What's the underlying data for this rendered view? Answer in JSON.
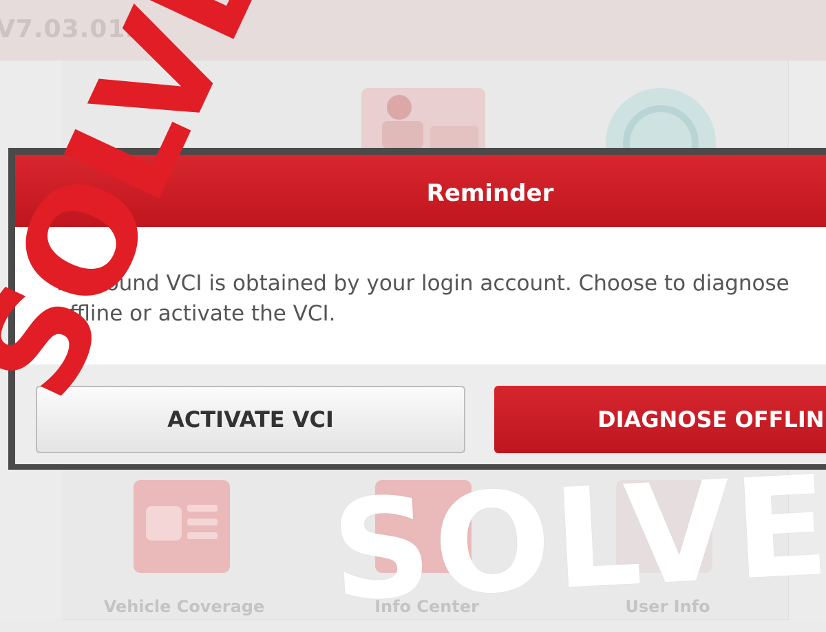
{
  "app": {
    "version": "V7.03.012"
  },
  "tiles": [
    {
      "label": "",
      "icon": "mechanic-icon"
    },
    {
      "label": "",
      "icon": "update-icon"
    },
    {
      "label": "Vehicle Coverage",
      "icon": "vehicle-coverage-icon"
    },
    {
      "label": "Info Center",
      "icon": "info-center-icon"
    },
    {
      "label": "User Info",
      "icon": "user-info-icon"
    }
  ],
  "dialog": {
    "title": "Reminder",
    "message": "No bound VCI is obtained by your login account. Choose to diagnose offline or activate the VCI.",
    "activate_label": "ACTIVATE VCI",
    "offline_label": "DIAGNOSE OFFLINE"
  },
  "overlay": {
    "left_text": "SOLVED",
    "right_text": "SOLVED",
    "left_color": "#e11d25",
    "right_color": "#ffffff"
  },
  "colors": {
    "accent_red": "#c8161f",
    "header_gray": "#e6dcdc"
  }
}
